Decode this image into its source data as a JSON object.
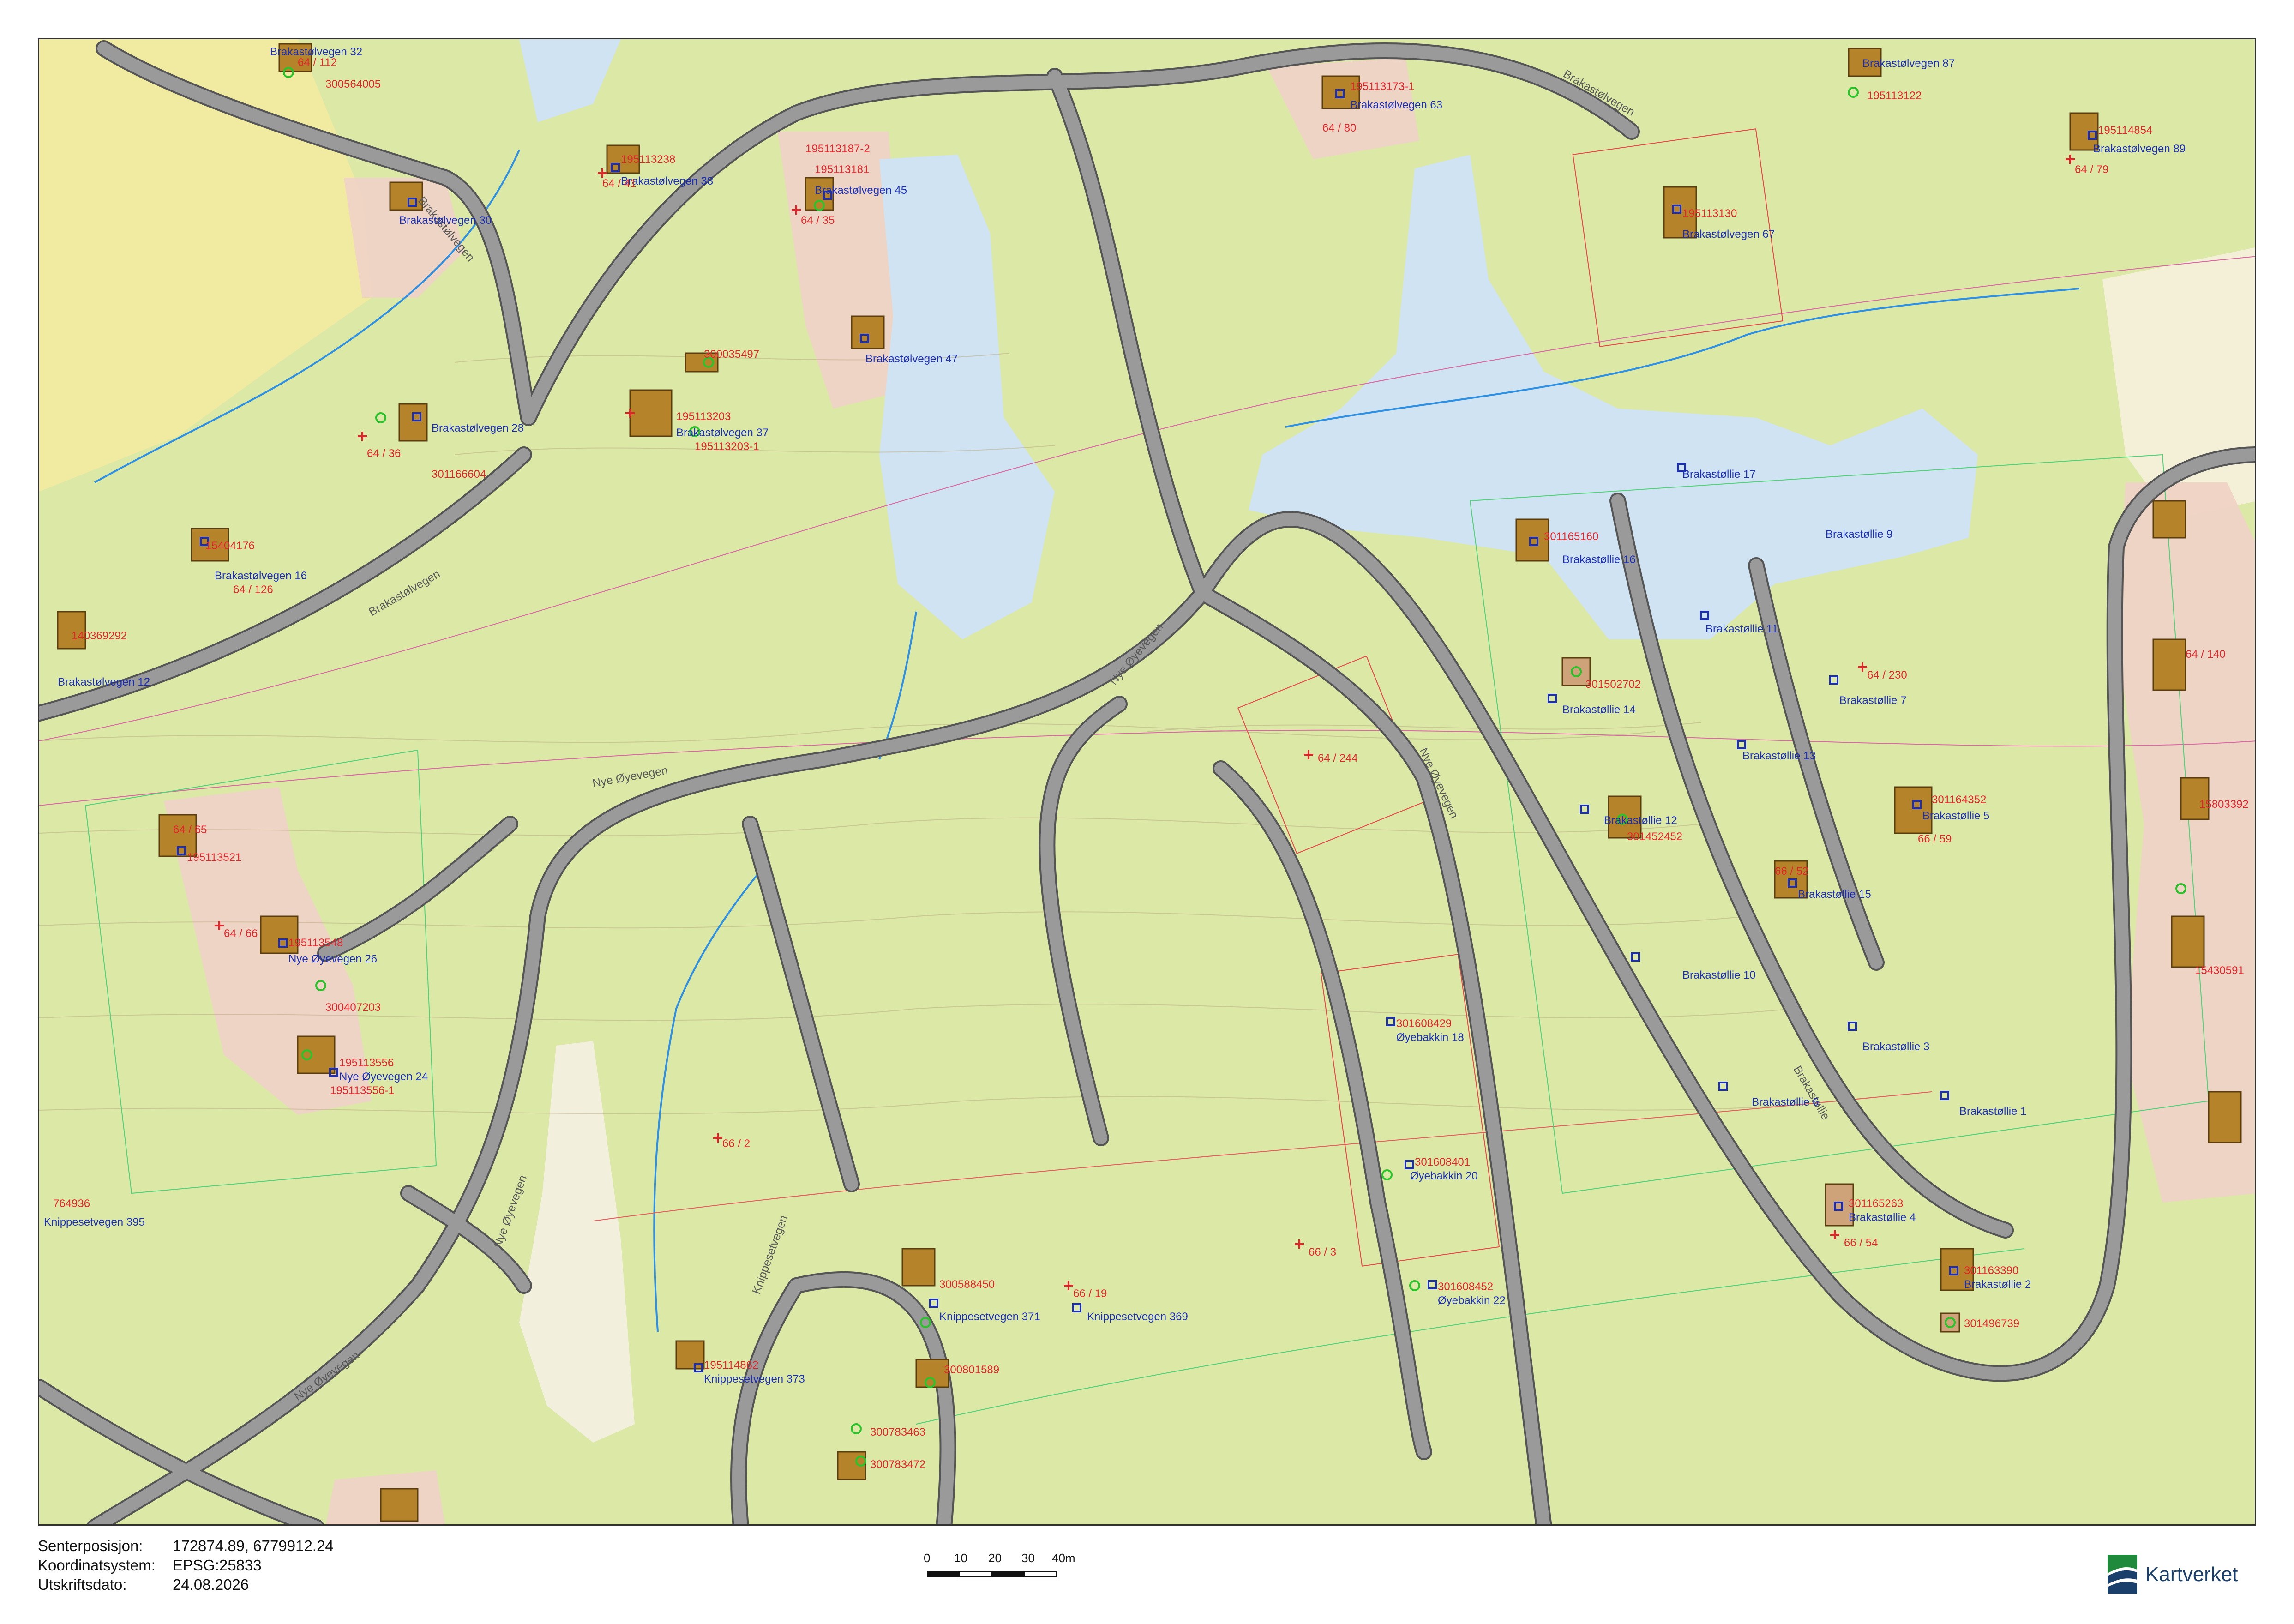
{
  "map": {
    "colors": {
      "background": "#dbe8a6",
      "water": "#cfe3f2",
      "road": "#9a9a9a",
      "road_edge": "#555555",
      "residential": "#efd3c6",
      "building": "#b5842a",
      "marker_red": "#e0262b",
      "marker_blue": "#1a2fb5",
      "marker_green": "#2cc22c"
    },
    "road_labels": [
      {
        "text": "Brakastølvegen"
      },
      {
        "text": "Brakastølvegen"
      },
      {
        "text": "Brakastølvegen"
      },
      {
        "text": "Nye Øyevegen"
      },
      {
        "text": "Nye Øyevegen"
      },
      {
        "text": "Nye Øyevegen"
      },
      {
        "text": "Nye Øyevegen"
      },
      {
        "text": "Nye Øyevegen"
      },
      {
        "text": "Brakastøllie"
      },
      {
        "text": "Knippesetvegen"
      }
    ],
    "address_labels": [
      {
        "text": "Brakastølvegen 32"
      },
      {
        "text": "Brakastølvegen 30"
      },
      {
        "text": "Brakastølvegen 38"
      },
      {
        "text": "Brakastølvegen 45"
      },
      {
        "text": "Brakastølvegen 47"
      },
      {
        "text": "Brakastølvegen 28"
      },
      {
        "text": "Brakastølvegen 37"
      },
      {
        "text": "Brakastølvegen 16"
      },
      {
        "text": "Brakastølvegen 12"
      },
      {
        "text": "Brakastølvegen 63"
      },
      {
        "text": "Brakastølvegen 67"
      },
      {
        "text": "Brakastølvegen 87"
      },
      {
        "text": "Brakastølvegen 89"
      },
      {
        "text": "Brakastøllie 17"
      },
      {
        "text": "Brakastøllie 9"
      },
      {
        "text": "Brakastøllie 16"
      },
      {
        "text": "Brakastøllie 11"
      },
      {
        "text": "Brakastøllie 14"
      },
      {
        "text": "Brakastøllie 7"
      },
      {
        "text": "Brakastøllie 13"
      },
      {
        "text": "Brakastøllie 12"
      },
      {
        "text": "Brakastøllie 5"
      },
      {
        "text": "Brakastøllie 15"
      },
      {
        "text": "Brakastøllie 10"
      },
      {
        "text": "Brakastøllie 3"
      },
      {
        "text": "Brakastøllie 6"
      },
      {
        "text": "Brakastøllie 1"
      },
      {
        "text": "Brakastøllie 4"
      },
      {
        "text": "Brakastøllie 2"
      },
      {
        "text": "Nye Øyevegen 26"
      },
      {
        "text": "Nye Øyevegen 24"
      },
      {
        "text": "Øyebakkin 18"
      },
      {
        "text": "Øyebakkin 20"
      },
      {
        "text": "Øyebakkin 22"
      },
      {
        "text": "Knippesetvegen 371"
      },
      {
        "text": "Knippesetvegen 369"
      },
      {
        "text": "Knippesetvegen 373"
      },
      {
        "text": "Knippesetvegen 395"
      }
    ],
    "parcel_labels": [
      {
        "text": "64 / 112"
      },
      {
        "text": "64 / 41"
      },
      {
        "text": "64 / 35"
      },
      {
        "text": "64 / 36"
      },
      {
        "text": "64 / 126"
      },
      {
        "text": "64 / 80"
      },
      {
        "text": "64 / 79"
      },
      {
        "text": "64 / 244"
      },
      {
        "text": "64 / 230"
      },
      {
        "text": "66 / 59"
      },
      {
        "text": "66 / 52"
      },
      {
        "text": "64 / 65"
      },
      {
        "text": "64 / 66"
      },
      {
        "text": "66 / 2"
      },
      {
        "text": "66 / 3"
      },
      {
        "text": "66 / 19"
      },
      {
        "text": "66 / 54"
      },
      {
        "text": "64 / 140"
      }
    ],
    "object_ids": [
      {
        "text": "300564005"
      },
      {
        "text": "195113238"
      },
      {
        "text": "195113187-2"
      },
      {
        "text": "195113181"
      },
      {
        "text": "300035497"
      },
      {
        "text": "195113203"
      },
      {
        "text": "195113203-1"
      },
      {
        "text": "301166604"
      },
      {
        "text": "15404176"
      },
      {
        "text": "140369292"
      },
      {
        "text": "195113173-1"
      },
      {
        "text": "195113130"
      },
      {
        "text": "195113122"
      },
      {
        "text": "195114854"
      },
      {
        "text": "301165160"
      },
      {
        "text": "301502702"
      },
      {
        "text": "301164352"
      },
      {
        "text": "301452452"
      },
      {
        "text": "15430591"
      },
      {
        "text": "195113521"
      },
      {
        "text": "195113548"
      },
      {
        "text": "300407203"
      },
      {
        "text": "195113556"
      },
      {
        "text": "195113556-1"
      },
      {
        "text": "301608429"
      },
      {
        "text": "301608401"
      },
      {
        "text": "301608452"
      },
      {
        "text": "300588450"
      },
      {
        "text": "300801589"
      },
      {
        "text": "195114862"
      },
      {
        "text": "300783463"
      },
      {
        "text": "300783472"
      },
      {
        "text": "301165263"
      },
      {
        "text": "301163390"
      },
      {
        "text": "301496739"
      },
      {
        "text": "15803392"
      },
      {
        "text": "764936"
      }
    ]
  },
  "footer": {
    "center_position_label": "Senterposisjon:",
    "center_position_value": "172874.89, 6779912.24",
    "coord_system_label": "Koordinatsystem:",
    "coord_system_value": "EPSG:25833",
    "print_date_label": "Utskriftsdato:",
    "print_date_value": "24.08.2026",
    "scale_ticks": [
      "0",
      "10",
      "20",
      "30",
      "40m"
    ],
    "logo_text": "Kartverket"
  }
}
